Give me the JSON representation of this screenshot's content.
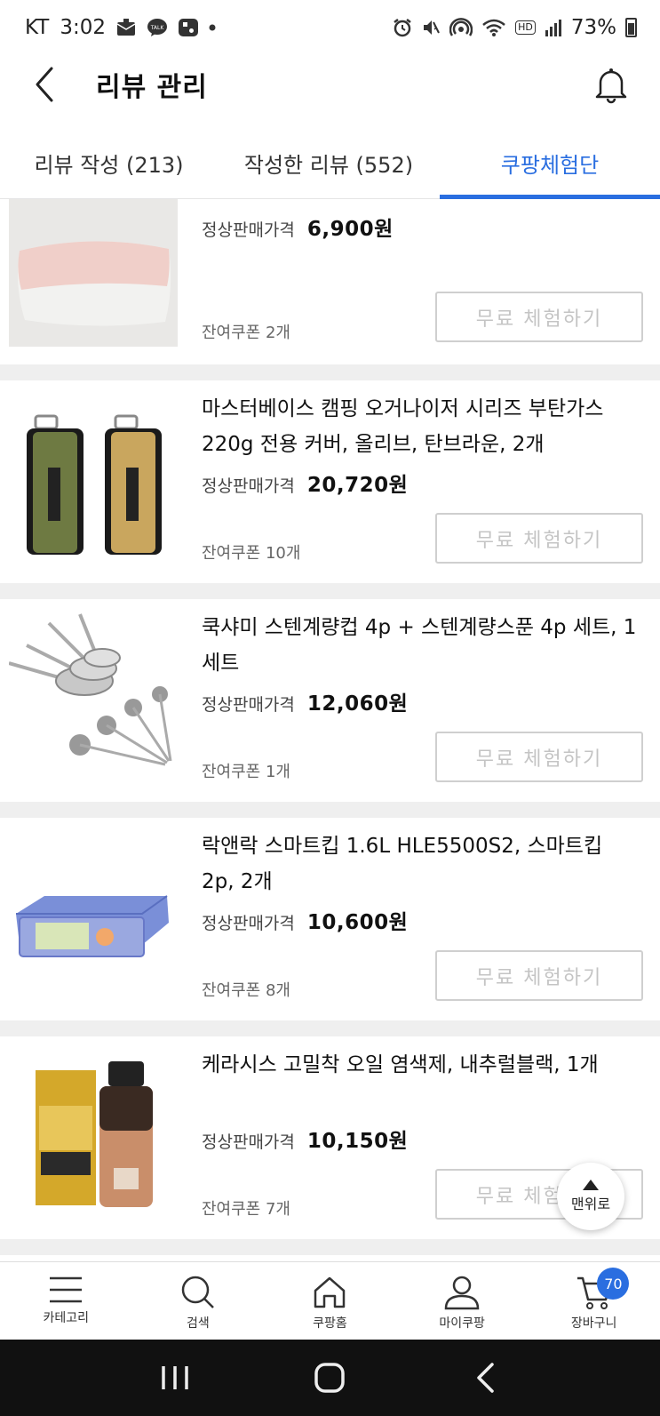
{
  "status_bar": {
    "carrier": "KT",
    "time": "3:02",
    "battery": "73%",
    "hd": "HD",
    "icons": [
      "mail-icon",
      "kakaotalk-icon",
      "app-icon",
      "dot-icon",
      "alarm-icon",
      "mute-icon",
      "hotspot-icon",
      "wifi-icon",
      "hd-icon",
      "signal-icon",
      "battery-icon"
    ]
  },
  "header": {
    "title": "리뷰 관리",
    "back_icon": "chevron-left-icon",
    "bell_icon": "bell-icon"
  },
  "tabs": [
    {
      "label": "리뷰 작성 (213)",
      "active": false
    },
    {
      "label": "작성한 리뷰 (552)",
      "active": true
    },
    {
      "label": "쿠팡체험단",
      "active": true
    }
  ],
  "items": [
    {
      "name": "",
      "price_label": "정상판매가격",
      "price": "6,900원",
      "coupon": "잔여쿠폰 2개",
      "button": "무료 체험하기",
      "image": "pillow"
    },
    {
      "name": "마스터베이스 캠핑 오거나이저 시리즈 부탄가스 220g 전용 커버, 올리브, 탄브라운, 2개",
      "price_label": "정상판매가격",
      "price": "20,720원",
      "coupon": "잔여쿠폰 10개",
      "button": "무료 체험하기",
      "image": "gas-covers"
    },
    {
      "name": "쿡샤미 스텐계량컵 4p + 스텐계량스푼 4p 세트, 1세트",
      "price_label": "정상판매가격",
      "price": "12,060원",
      "coupon": "잔여쿠폰 1개",
      "button": "무료 체험하기",
      "image": "measuring-cups"
    },
    {
      "name": "락앤락 스마트킵 1.6L HLE5500S2, 스마트킵 2p, 2개",
      "price_label": "정상판매가격",
      "price": "10,600원",
      "coupon": "잔여쿠폰 8개",
      "button": "무료 체험하기",
      "image": "food-container"
    },
    {
      "name": "케라시스 고밀착 오일 염색제, 내추럴블랙, 1개",
      "price_label": "정상판매가격",
      "price": "10,150원",
      "coupon": "잔여쿠폰 7개",
      "button": "무료 체험하기",
      "image": "hair-dye"
    }
  ],
  "top_button": {
    "label": "맨위로",
    "icon": "triangle-up-icon"
  },
  "bottom_nav": [
    {
      "label": "카테고리",
      "icon": "menu-icon"
    },
    {
      "label": "검색",
      "icon": "search-icon"
    },
    {
      "label": "쿠팡홈",
      "icon": "home-icon"
    },
    {
      "label": "마이쿠팡",
      "icon": "user-icon"
    },
    {
      "label": "장바구니",
      "icon": "cart-icon",
      "badge": "70"
    }
  ],
  "colors": {
    "accent": "#2a6ee0",
    "separator": "#efefef",
    "button_text": "#c4c4c4"
  }
}
